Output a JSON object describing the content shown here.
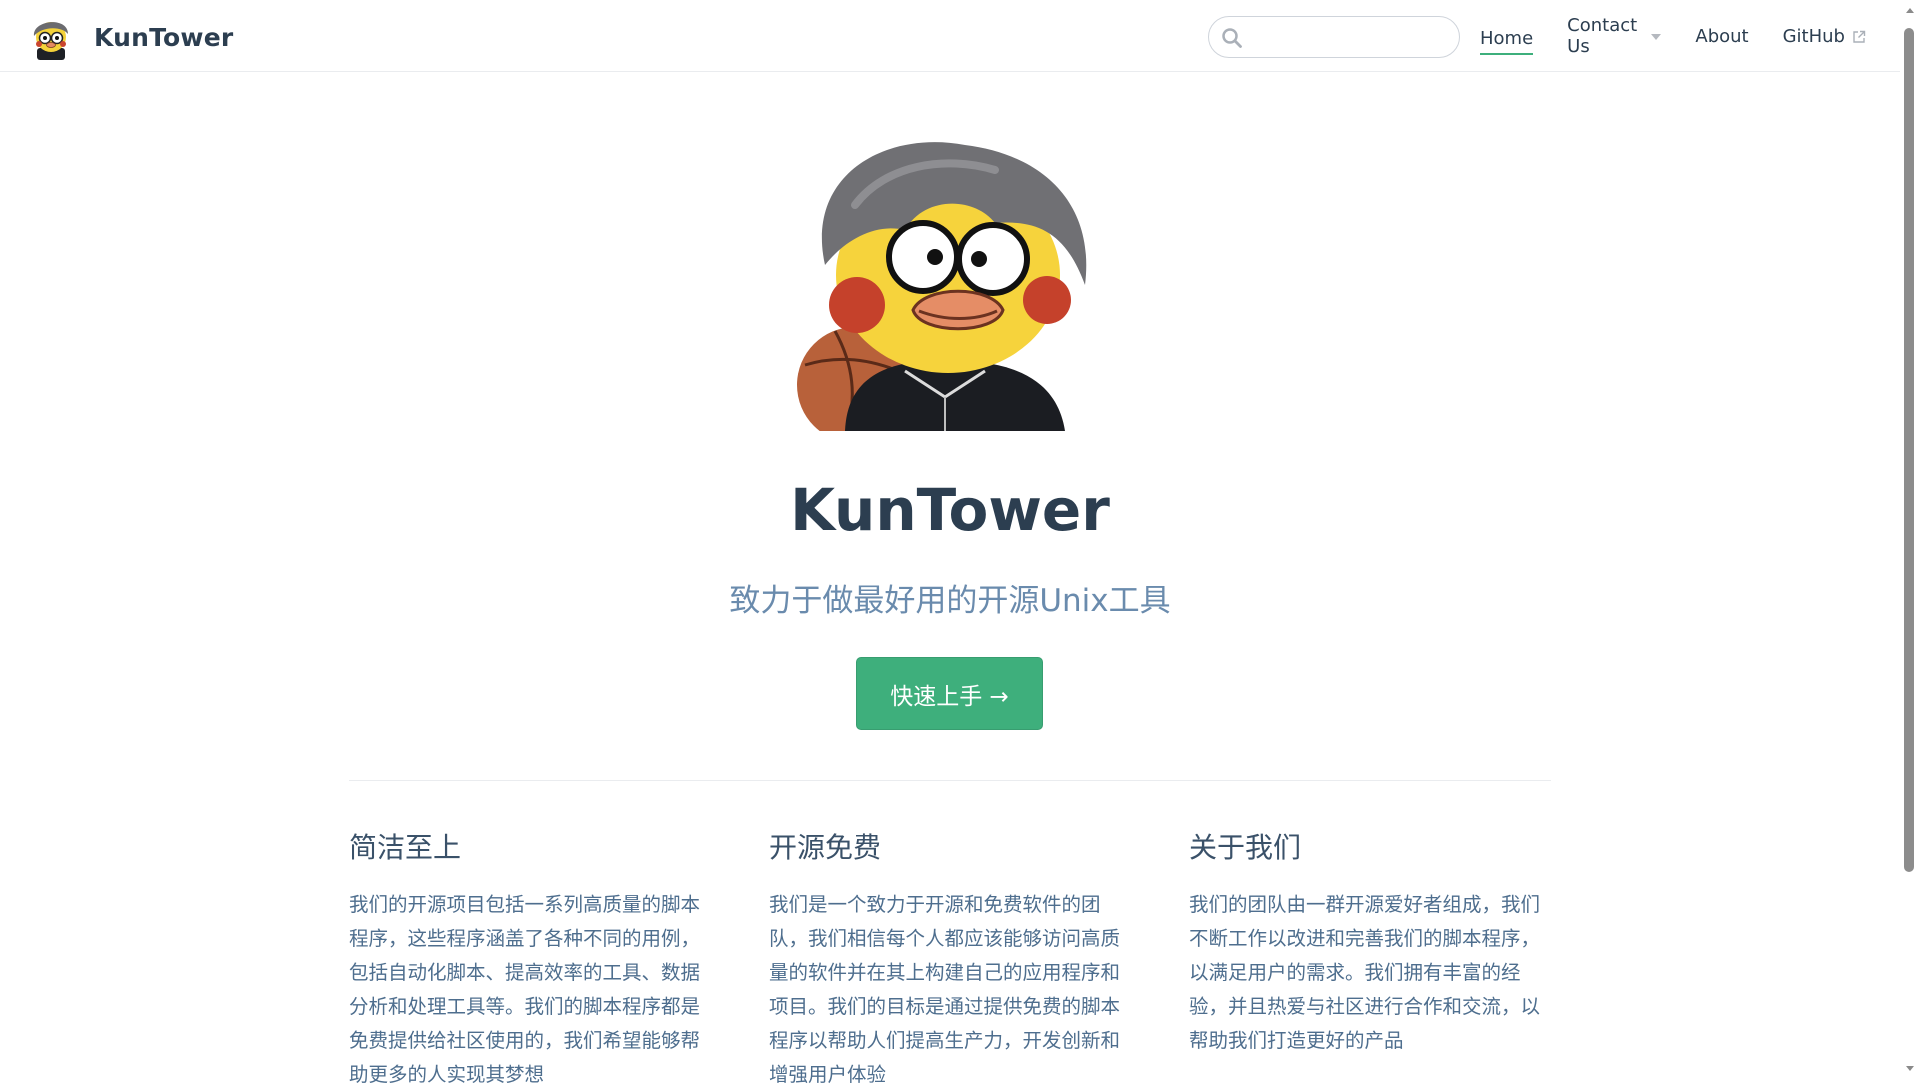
{
  "navbar": {
    "brand_name": "KunTower",
    "search": {
      "value": "",
      "placeholder": ""
    },
    "links": [
      {
        "label": "Home",
        "active": true
      },
      {
        "label": "Contact Us",
        "dropdown": true
      },
      {
        "label": "About"
      },
      {
        "label": "GitHub",
        "external": true
      }
    ]
  },
  "hero": {
    "title": "KunTower",
    "tagline": "致力于做最好用的开源Unix工具",
    "cta_label": "快速上手 →"
  },
  "features": [
    {
      "title": "简洁至上",
      "body": "我们的开源项目包括一系列高质量的脚本程序，这些程序涵盖了各种不同的用例，包括自动化脚本、提高效率的工具、数据分析和处理工具等。我们的脚本程序都是免费提供给社区使用的，我们希望能够帮助更多的人实现其梦想"
    },
    {
      "title": "开源免费",
      "body": "我们是一个致力于开源和免费软件的团队，我们相信每个人都应该能够访问高质量的软件并在其上构建自己的应用程序和项目。我们的目标是通过提供免费的脚本程序以帮助人们提高生产力，开发创新和增强用户体验"
    },
    {
      "title": "关于我们",
      "body": "我们的团队由一群开源爱好者组成，我们不断工作以改进和完善我们的脚本程序，以满足用户的需求。我们拥有丰富的经验，并且热爱与社区进行合作和交流，以帮助我们打造更好的产品"
    }
  ],
  "colors": {
    "accent": "#3eaf7c",
    "text": "#2c3e50",
    "tagline": "#6a8bad",
    "border": "#eaecef"
  },
  "icons": [
    "kun-mascot-icon",
    "search-icon",
    "chevron-down-icon",
    "external-link-icon"
  ]
}
